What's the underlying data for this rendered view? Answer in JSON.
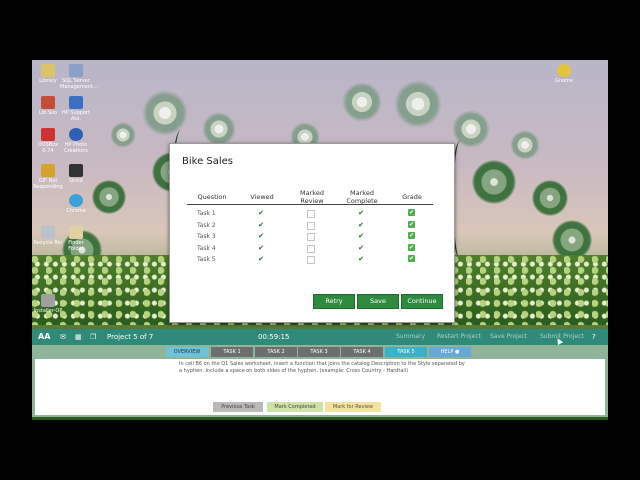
{
  "desktop": {
    "icons": [
      {
        "label": "Library",
        "color": "#d9c46a"
      },
      {
        "label": "SQL Server Management...",
        "color": "#8aa0c8"
      },
      {
        "label": "Gnome",
        "color": "#e3c33a"
      },
      {
        "label": "Lib Silo",
        "color": "#c44d3a"
      },
      {
        "label": "HP Support Ass.",
        "color": "#3a6fc4"
      },
      {
        "label": "DOSBox 0.74",
        "color": "#cc3333"
      },
      {
        "label": "HP Photo Creations",
        "color": "#2e5fb0"
      },
      {
        "label": "GIF Not Responding",
        "color": "#d4a330"
      },
      {
        "label": "Droid",
        "color": "#333333"
      },
      {
        "label": "Chrome",
        "color": "#3fa0d8"
      },
      {
        "label": "Recycle Bin",
        "color": "#b9c2cc"
      },
      {
        "label": "Finder Folder",
        "color": "#e0d1a0"
      },
      {
        "label": "Installer-OP",
        "color": "#a0a0a0"
      }
    ]
  },
  "dialog": {
    "title": "Bike Sales",
    "headers": [
      "Question",
      "Viewed",
      "Marked Review",
      "Marked Complete",
      "Grade"
    ],
    "rows": [
      {
        "task": "Task 1",
        "viewed": true,
        "review": false,
        "complete": true,
        "grade": true
      },
      {
        "task": "Task 2",
        "viewed": true,
        "review": false,
        "complete": true,
        "grade": true
      },
      {
        "task": "Task 3",
        "viewed": true,
        "review": false,
        "complete": true,
        "grade": true
      },
      {
        "task": "Task 4",
        "viewed": true,
        "review": false,
        "complete": true,
        "grade": true
      },
      {
        "task": "Task 5",
        "viewed": true,
        "review": false,
        "complete": true,
        "grade": true
      }
    ],
    "buttons": {
      "retry": "Retry",
      "save": "Save",
      "continue": "Continue"
    }
  },
  "taskbar": {
    "font_label": "AA",
    "project_label": "Project 5 of 7",
    "timer": "00:59:15",
    "links": {
      "summary": "Summary",
      "restart": "Restart Project",
      "save": "Save Project",
      "submit": "Submit Project",
      "help": "?"
    },
    "tabs": [
      "OVERVIEW",
      "TASK 1",
      "TASK 2",
      "TASK 3",
      "TASK 4",
      "TASK 5",
      "HELP"
    ],
    "instruction": "In cell B6 on the Q1 Sales worksheet, insert a function that joins the catalog Description to the Style separated by a hyphen. Include a space on both sides of the hyphen. (example: Cross Country - Hardtail)",
    "footer_buttons": {
      "previous": "Previous Task",
      "complete": "Mark Completed",
      "review": "Mark for Review"
    }
  }
}
